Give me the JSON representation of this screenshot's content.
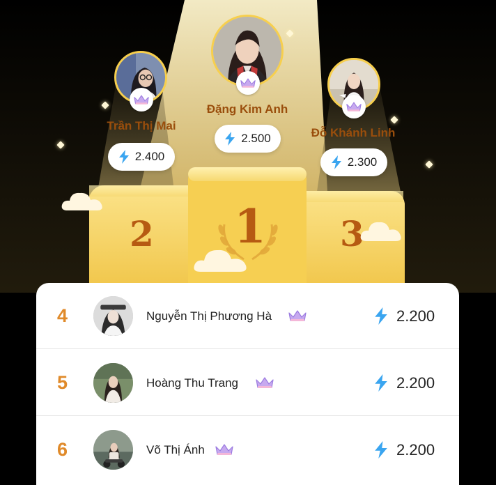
{
  "top_three": [
    {
      "rank": 1,
      "name": "Đặng Kim Anh",
      "score": "2.500",
      "avatar": "portrait-student-graduation"
    },
    {
      "rank": 2,
      "name": "Trần Thị Mai",
      "score": "2.400",
      "avatar": "portrait-girl-glasses"
    },
    {
      "rank": 3,
      "name": "Đỗ Khánh Linh",
      "score": "2.300",
      "avatar": "portrait-girl-white-dress"
    }
  ],
  "podium": {
    "first": "1",
    "second": "2",
    "third": "3"
  },
  "list": [
    {
      "rank": "4",
      "name": "Nguyễn Thị Phương Hà",
      "score": "2.200"
    },
    {
      "rank": "5",
      "name": "Hoàng Thu Trang",
      "score": "2.200"
    },
    {
      "rank": "6",
      "name": "Võ Thị Ánh",
      "score": "2.200"
    }
  ],
  "colors": {
    "gold": "#f7cf4d",
    "podium": "#f5d56a",
    "rank_orange": "#e08a2a",
    "bolt_blue": "#3aa5f0",
    "crown_purple": "#b79be8"
  },
  "icons": {
    "score": "lightning-bolt-icon",
    "badge": "crown-icon"
  }
}
